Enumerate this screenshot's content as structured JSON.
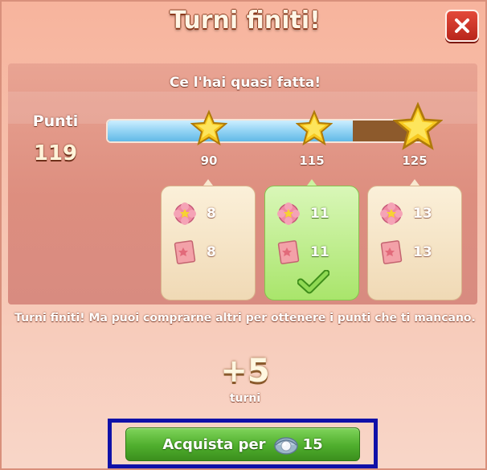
{
  "dialog": {
    "title": "Turni finiti!",
    "close_icon": "close-icon"
  },
  "progress": {
    "subtitle": "Ce l'hai quasi fatta!",
    "points_label": "Punti",
    "points_value": "119",
    "fill_fraction": 0.77,
    "milestones": [
      {
        "points": "90",
        "bar_position": 0.31,
        "reward_flower": "8",
        "reward_ticket": "8",
        "achieved": false
      },
      {
        "points": "115",
        "bar_position": 0.64,
        "reward_flower": "11",
        "reward_ticket": "11",
        "achieved": true
      },
      {
        "points": "125",
        "bar_position": 0.97,
        "reward_flower": "13",
        "reward_ticket": "13",
        "achieved": false
      }
    ]
  },
  "message": "Turni finiti! Ma puoi comprarne altri per ottenere i punti che ti mancano.",
  "offer": {
    "amount": "+5",
    "unit": "turni"
  },
  "buy_button": {
    "label": "Acquista per",
    "currency_icon": "pearl-icon",
    "price": "15"
  },
  "colors": {
    "bar_fill": "#93d3f4",
    "achieved_card": "#a9e56b",
    "buy_button": "#4fae2d",
    "close_button": "#d0362a",
    "highlight_frame": "#1010a8"
  }
}
